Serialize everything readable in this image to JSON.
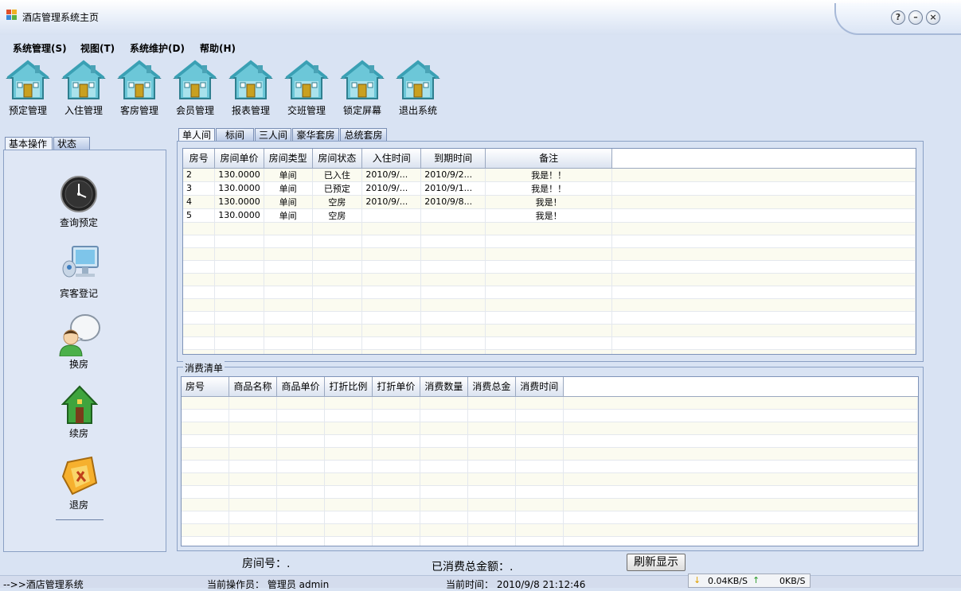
{
  "window": {
    "title": "酒店管理系统主页",
    "help_btn": "?",
    "min_btn": "–",
    "close_btn": "×"
  },
  "menu": [
    "系统管理(S)",
    "视图(T)",
    "系统维护(D)",
    "帮助(H)"
  ],
  "toolbar": [
    "预定管理",
    "入住管理",
    "客房管理",
    "会员管理",
    "报表管理",
    "交班管理",
    "锁定屏幕",
    "退出系统"
  ],
  "left_tabs": [
    "基本操作",
    "状态"
  ],
  "side_buttons": [
    "查询预定",
    "宾客登记",
    "换房",
    "续房",
    "退房"
  ],
  "room_tabs": [
    "单人间",
    "标间",
    "三人间",
    "豪华套房",
    "总统套房"
  ],
  "room_table": {
    "columns": [
      "房号",
      "房间单价",
      "房间类型",
      "房间状态",
      "入住时间",
      "到期时间",
      "备注"
    ],
    "rows": [
      [
        "2",
        "130.0000",
        "单间",
        "已入住",
        "2010/9/...",
        "2010/9/2...",
        "我是！！"
      ],
      [
        "3",
        "130.0000",
        "单间",
        "已预定",
        "2010/9/...",
        "2010/9/1...",
        "我是！！"
      ],
      [
        "4",
        "130.0000",
        "单间",
        "空房",
        "2010/9/...",
        "2010/9/8...",
        "我是！"
      ],
      [
        "5",
        "130.0000",
        "单间",
        "空房",
        "",
        "",
        "我是！"
      ]
    ]
  },
  "consumption": {
    "group_title": "消费清单",
    "columns": [
      "房号",
      "商品名称",
      "商品单价",
      "打折比例",
      "打折单价",
      "消费数量",
      "消费总金",
      "消费时间"
    ]
  },
  "footer": {
    "room_label": "房间号：.",
    "total_label": "已消费总金额：.",
    "refresh_btn": "刷新显示"
  },
  "statusbar": {
    "app": "-->>酒店管理系统",
    "operator": "当前操作员： 管理员 admin",
    "time": "当前时间： 2010/9/8 21:12:46"
  },
  "network": {
    "down": "0.04KB/S",
    "up": "0KB/S"
  }
}
